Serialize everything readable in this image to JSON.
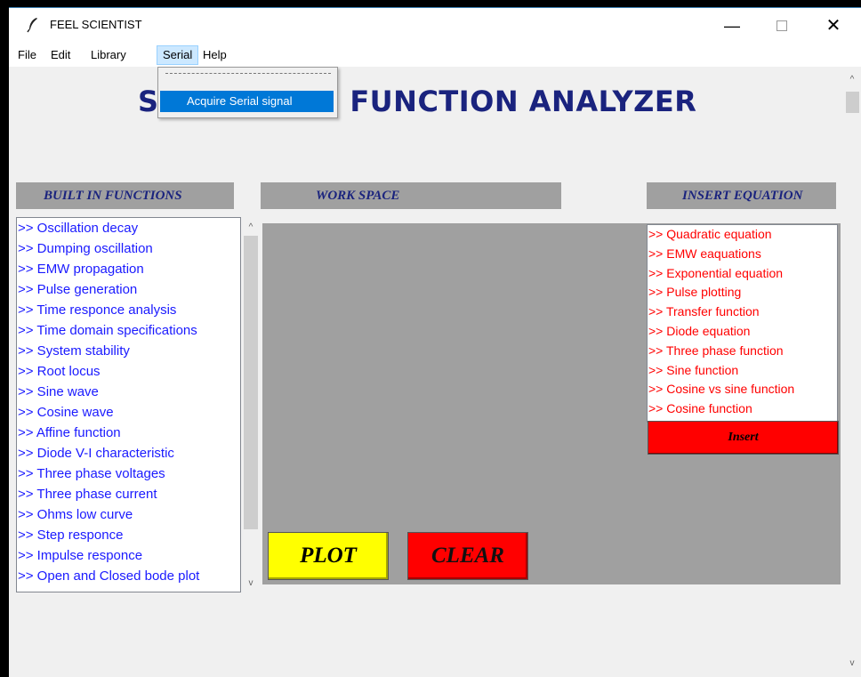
{
  "window": {
    "title": "FEEL SCIENTIST",
    "minimize": "—",
    "close": "✕"
  },
  "menubar": {
    "items": [
      {
        "label": "File"
      },
      {
        "label": "Edit"
      },
      {
        "label": "Library"
      },
      {
        "label": "Serial"
      },
      {
        "label": "Help"
      }
    ],
    "active": "Serial"
  },
  "serial_menu": {
    "items": [
      {
        "label": "Acquire Serial signal"
      }
    ]
  },
  "heading": {
    "visible_left": "S",
    "visible_right": ") FUNCTION ANALYZER"
  },
  "sections": {
    "builtin": "BUILT IN FUNCTIONS",
    "workspace": "WORK SPACE",
    "insert": "INSERT EQUATION"
  },
  "builtin_functions": [
    ">> Oscillation decay",
    ">> Dumping oscillation",
    ">> EMW propagation",
    ">> Pulse generation",
    ">> Time responce analysis",
    ">> Time domain specifications",
    ">> System stability",
    ">> Root locus",
    ">> Sine wave",
    ">> Cosine wave",
    ">> Affine function",
    ">> Diode V-I characteristic",
    ">> Three phase voltages",
    ">> Three phase current",
    ">> Ohms low curve",
    ">> Step responce",
    ">> Impulse responce",
    ">> Open and Closed bode plot"
  ],
  "insert_equations": [
    ">> Quadratic equation",
    ">> EMW eaquations",
    ">> Exponential equation",
    ">> Pulse plotting",
    ">> Transfer function",
    ">> Diode equation",
    ">> Three phase function",
    ">> Sine function",
    ">> Cosine vs sine function",
    ">> Cosine function"
  ],
  "buttons": {
    "insert": "Insert",
    "plot": "PLOT",
    "clear": "CLEAR"
  },
  "icons": {
    "app": "feather-icon",
    "scroll_up": "chevron-up-icon",
    "scroll_down": "chevron-down-icon"
  },
  "colors": {
    "heading": "#1a237e",
    "builtin_text": "#1a1aff",
    "equation_text": "#ff0000",
    "plot_button": "#ffff00",
    "clear_button": "#ff0000",
    "workspace": "#a0a0a0",
    "menu_highlight": "#0078d7"
  }
}
